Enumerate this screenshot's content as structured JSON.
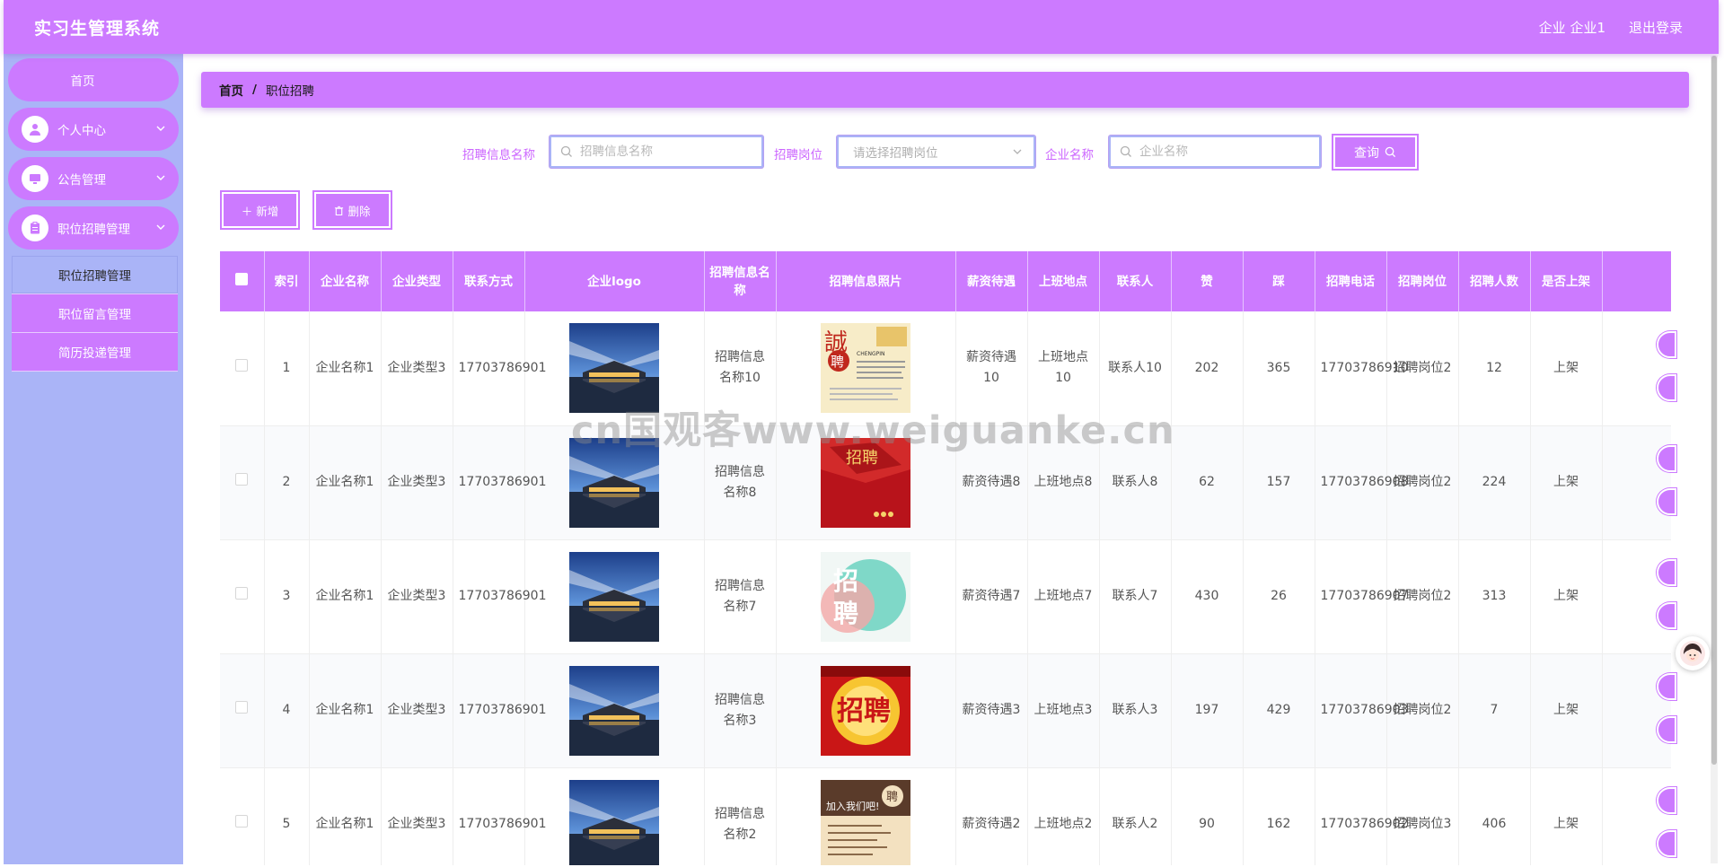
{
  "header": {
    "title": "实习生管理系统",
    "user": "企业 企业1",
    "logout": "退出登录"
  },
  "sidebar": {
    "home": "首页",
    "menus": [
      {
        "label": "个人中心",
        "icon": "user-icon"
      },
      {
        "label": "公告管理",
        "icon": "monitor-icon"
      },
      {
        "label": "职位招聘管理",
        "icon": "clipboard-icon"
      }
    ],
    "submenu": [
      {
        "label": "职位招聘管理",
        "active": true
      },
      {
        "label": "职位留言管理",
        "active": false
      },
      {
        "label": "简历投递管理",
        "active": false
      }
    ]
  },
  "breadcrumb": {
    "home": "首页",
    "separator": "/",
    "current": "职位招聘"
  },
  "search": {
    "name_label": "招聘信息名称",
    "name_placeholder": "招聘信息名称",
    "post_label": "招聘岗位",
    "post_placeholder": "请选择招聘岗位",
    "company_label": "企业名称",
    "company_placeholder": "企业名称",
    "query_button": "查询"
  },
  "actions": {
    "add": "新增",
    "delete": "删除"
  },
  "table": {
    "columns": [
      "索引",
      "企业名称",
      "企业类型",
      "联系方式",
      "企业logo",
      "招聘信息名称",
      "招聘信息照片",
      "薪资待遇",
      "上班地点",
      "联系人",
      "赞",
      "踩",
      "招聘电话",
      "招聘岗位",
      "招聘人数",
      "是否上架"
    ],
    "rows": [
      {
        "index": "1",
        "company": "企业名称1",
        "type": "企业类型3",
        "phone": "17703786901",
        "info_name": "招聘信息名称10",
        "salary": "薪资待遇10",
        "location": "上班地点10",
        "contact": "联系人10",
        "like": "202",
        "dislike": "365",
        "hire_phone": "17703786910",
        "post": "招聘岗位2",
        "count": "12",
        "status": "上架",
        "poster": "poster-chengpin"
      },
      {
        "index": "2",
        "company": "企业名称1",
        "type": "企业类型3",
        "phone": "17703786901",
        "info_name": "招聘信息名称8",
        "salary": "薪资待遇8",
        "location": "上班地点8",
        "contact": "联系人8",
        "like": "62",
        "dislike": "157",
        "hire_phone": "17703786908",
        "post": "招聘岗位2",
        "count": "224",
        "status": "上架",
        "poster": "poster-red"
      },
      {
        "index": "3",
        "company": "企业名称1",
        "type": "企业类型3",
        "phone": "17703786901",
        "info_name": "招聘信息名称7",
        "salary": "薪资待遇7",
        "location": "上班地点7",
        "contact": "联系人7",
        "like": "430",
        "dislike": "26",
        "hire_phone": "17703786907",
        "post": "招聘岗位2",
        "count": "313",
        "status": "上架",
        "poster": "poster-teal"
      },
      {
        "index": "4",
        "company": "企业名称1",
        "type": "企业类型3",
        "phone": "17703786901",
        "info_name": "招聘信息名称3",
        "salary": "薪资待遇3",
        "location": "上班地点3",
        "contact": "联系人3",
        "like": "197",
        "dislike": "429",
        "hire_phone": "17703786903",
        "post": "招聘岗位2",
        "count": "7",
        "status": "上架",
        "poster": "poster-gold"
      },
      {
        "index": "5",
        "company": "企业名称1",
        "type": "企业类型3",
        "phone": "17703786901",
        "info_name": "招聘信息名称2",
        "salary": "薪资待遇2",
        "location": "上班地点2",
        "contact": "联系人2",
        "like": "90",
        "dislike": "162",
        "hire_phone": "17703786902",
        "post": "招聘岗位3",
        "count": "406",
        "status": "上架",
        "poster": "poster-join"
      }
    ]
  },
  "watermark": "cn国观客www.weiguanke.cn",
  "colors": {
    "primary": "#cc7aff",
    "sidebar": "#aab4f7"
  }
}
